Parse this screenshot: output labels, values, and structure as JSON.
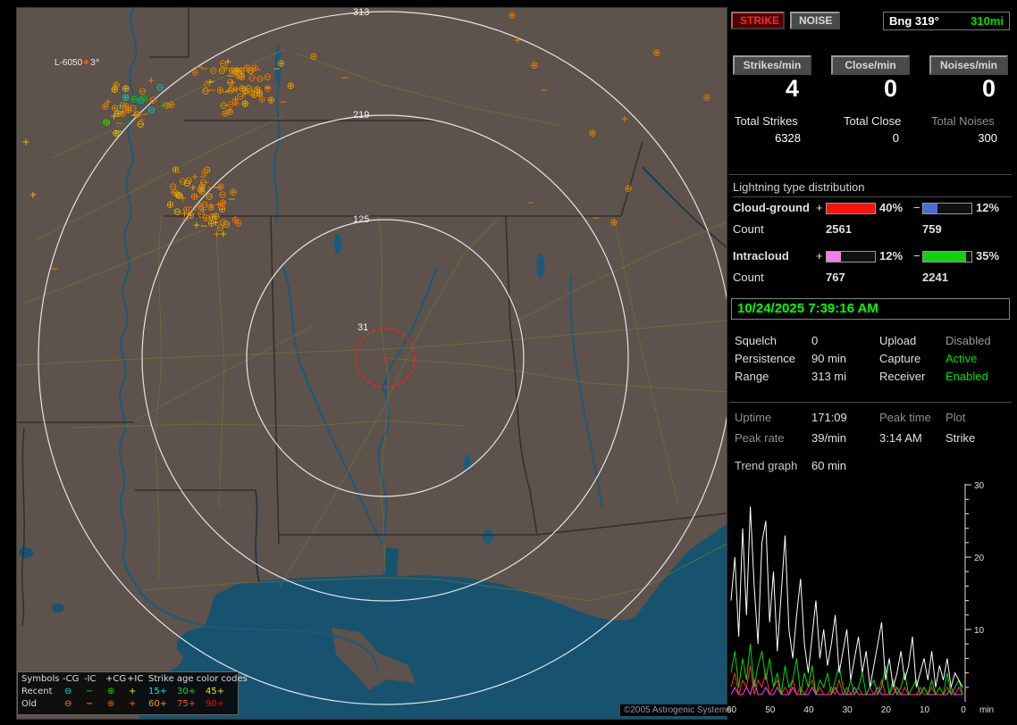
{
  "app": {
    "copyright": "©2005 Astrogenic Systems"
  },
  "map": {
    "station_label": "L-6050",
    "station_extra": "3^",
    "ring_labels": [
      "313",
      "219",
      "125",
      "31"
    ],
    "legend": {
      "header_symbols": "Symbols",
      "columns": [
        "-CG",
        "-IC",
        "+CG",
        "+IC"
      ],
      "header_ages": "Strike age color codes",
      "rows": [
        {
          "label": "Recent",
          "symbols": [
            {
              "g": "⊖",
              "c": "#00e8e8"
            },
            {
              "g": "−",
              "c": "#00e800"
            },
            {
              "g": "⊕",
              "c": "#00e800"
            },
            {
              "g": "+",
              "c": "#e8e800"
            }
          ],
          "ages": [
            {
              "t": "15+",
              "c": "#00e8e8"
            },
            {
              "t": "30+",
              "c": "#00e800"
            },
            {
              "t": "45+",
              "c": "#e8e800"
            }
          ]
        },
        {
          "label": "Old",
          "symbols": [
            {
              "g": "⊖",
              "c": "#ff9400"
            },
            {
              "g": "−",
              "c": "#ff9400"
            },
            {
              "g": "⊕",
              "c": "#ff6000"
            },
            {
              "g": "+",
              "c": "#ff6000"
            }
          ],
          "ages": [
            {
              "t": "60+",
              "c": "#ff9400"
            },
            {
              "t": "75+",
              "c": "#ff5000"
            },
            {
              "t": "90+",
              "c": "#ff0000"
            }
          ]
        }
      ]
    },
    "strike_clusters": [
      {
        "cx": 247,
        "cy": 88,
        "rx": 62,
        "ry": 34,
        "count": 72,
        "palette": [
          "#ff9400",
          "#ffb000",
          "#ff8000",
          "#ffcf00"
        ],
        "weights": [
          0.45,
          0.3,
          0.15,
          0.1
        ]
      },
      {
        "cx": 132,
        "cy": 118,
        "rx": 46,
        "ry": 38,
        "count": 40,
        "palette": [
          "#ff9400",
          "#ffcf00",
          "#00e000",
          "#00e0e0",
          "#ff6000"
        ],
        "weights": [
          0.45,
          0.2,
          0.15,
          0.12,
          0.08
        ]
      },
      {
        "cx": 210,
        "cy": 218,
        "rx": 44,
        "ry": 42,
        "count": 62,
        "palette": [
          "#ff9400",
          "#ff8000",
          "#ffb000",
          "#ffcf00"
        ],
        "weights": [
          0.45,
          0.25,
          0.2,
          0.1
        ]
      }
    ],
    "scatter_strikes": [
      {
        "x": 554,
        "y": 8,
        "s": "⊕",
        "c": "#ff9400"
      },
      {
        "x": 560,
        "y": 36,
        "s": "+",
        "c": "#ff9400"
      },
      {
        "x": 579,
        "y": 64,
        "s": "⊕",
        "c": "#ff9400"
      },
      {
        "x": 590,
        "y": 92,
        "s": "−",
        "c": "#ff9400"
      },
      {
        "x": 644,
        "y": 140,
        "s": "⊕",
        "c": "#ff9400"
      },
      {
        "x": 680,
        "y": 124,
        "s": "+",
        "c": "#ff9400"
      },
      {
        "x": 684,
        "y": 202,
        "s": "⊕",
        "c": "#ff9400"
      },
      {
        "x": 668,
        "y": 240,
        "s": "⊕",
        "c": "#ff9400"
      },
      {
        "x": 648,
        "y": 235,
        "s": "−",
        "c": "#ff9400"
      },
      {
        "x": 575,
        "y": 218,
        "s": "−",
        "c": "#ff8000"
      },
      {
        "x": 332,
        "y": 54,
        "s": "⊕",
        "c": "#ff9400"
      },
      {
        "x": 367,
        "y": 78,
        "s": "−",
        "c": "#ff9400"
      },
      {
        "x": 18,
        "y": 209,
        "s": "+",
        "c": "#ffcf00"
      },
      {
        "x": 42,
        "y": 292,
        "s": "−",
        "c": "#ff9400"
      },
      {
        "x": 10,
        "y": 150,
        "s": "+",
        "c": "#ffcf00"
      },
      {
        "x": 716,
        "y": 50,
        "s": "⊕",
        "c": "#ff9400"
      },
      {
        "x": 772,
        "y": 100,
        "s": "⊕",
        "c": "#ff8000"
      }
    ]
  },
  "panel": {
    "strike_btn": "STRIKE",
    "noise_btn": "NOISE",
    "bearing_label": "Bng 319°",
    "bearing_range": "310mi",
    "rate_buttons": [
      "Strikes/min",
      "Close/min",
      "Noises/min"
    ],
    "rates": [
      "4",
      "0",
      "0"
    ],
    "totals": [
      {
        "label": "Total Strikes",
        "value": "6328"
      },
      {
        "label": "Total Close",
        "value": "0"
      },
      {
        "label": "Total Noises",
        "value": "300"
      }
    ],
    "distribution": {
      "title": "Lightning type distribution",
      "plus_sign": "+",
      "minus_sign": "−",
      "count_label": "Count",
      "rows": [
        {
          "name": "Cloud-ground",
          "plus_pct": "40%",
          "bar_plus_fill": 100,
          "plus_color": "#ff1010",
          "minus_pct": "12%",
          "bar_minus_fill": 30,
          "minus_color": "#4a6cd4",
          "count_plus": "2561",
          "count_minus": "759"
        },
        {
          "name": "Intracloud",
          "plus_pct": "12%",
          "bar_plus_fill": 30,
          "plus_color": "#f080e8",
          "minus_pct": "35%",
          "bar_minus_fill": 88,
          "minus_color": "#10d010",
          "count_plus": "767",
          "count_minus": "2241"
        }
      ]
    },
    "datetime": "10/24/2025 7:39:16 AM",
    "settings": [
      {
        "label": "Squelch",
        "value": "0",
        "label2": "Upload",
        "value2": "Disabled",
        "value2_color": "#9a9a9a"
      },
      {
        "label": "Persistence",
        "value": "90 min",
        "label2": "Capture",
        "value2": "Active",
        "value2_color": "#00e000"
      },
      {
        "label": "Range",
        "value": "313 mi",
        "label2": "Receiver",
        "value2": "Enabled",
        "value2_color": "#00e000"
      }
    ],
    "status": {
      "uptime_label": "Uptime",
      "uptime": "171:09",
      "peaktime_label": "Peak time",
      "peaktime": "3:14 AM",
      "plot_label": "Plot",
      "plot": "Strike",
      "peakrate_label": "Peak rate",
      "peakrate": "39/min"
    },
    "trend_label": "Trend graph",
    "trend_window": "60 min"
  },
  "chart_data": {
    "type": "line",
    "title": "Trend graph",
    "window_label": "60 min",
    "x_unit": "min",
    "x_range": [
      60,
      0
    ],
    "ylim": [
      0,
      30
    ],
    "x_ticks": [
      60,
      50,
      40,
      30,
      20,
      10,
      0
    ],
    "y_ticks": [
      10,
      20,
      30
    ],
    "legend_position": "none",
    "series": [
      {
        "name": "strike-rate",
        "color": "#ffffff",
        "values": [
          14,
          20,
          9,
          24,
          12,
          27,
          16,
          8,
          22,
          25,
          11,
          18,
          7,
          15,
          23,
          10,
          6,
          12,
          17,
          8,
          4,
          9,
          14,
          6,
          10,
          5,
          8,
          12,
          4,
          7,
          10,
          3,
          6,
          9,
          4,
          7,
          2,
          5,
          8,
          11,
          3,
          6,
          2,
          4,
          7,
          3,
          5,
          9,
          2,
          4,
          6,
          3,
          7,
          2,
          5,
          3,
          6,
          2,
          4,
          3,
          2
        ]
      },
      {
        "name": "cg-rate",
        "color": "#00dd00",
        "values": [
          4,
          7,
          2,
          6,
          3,
          8,
          2,
          5,
          7,
          3,
          6,
          2,
          4,
          1,
          5,
          2,
          3,
          6,
          1,
          4,
          2,
          5,
          1,
          3,
          2,
          4,
          1,
          3,
          5,
          2,
          1,
          3,
          1,
          2,
          4,
          1,
          2,
          3,
          1,
          2,
          5,
          1,
          3,
          1,
          2,
          4,
          1,
          2,
          3,
          1,
          2,
          1,
          3,
          1,
          2,
          1,
          4,
          1,
          2,
          3,
          1
        ]
      },
      {
        "name": "close-rate",
        "color": "#ff3030",
        "values": [
          2,
          4,
          1,
          3,
          2,
          5,
          1,
          3,
          2,
          4,
          1,
          2,
          3,
          1,
          2,
          1,
          3,
          1,
          2,
          1,
          2,
          3,
          1,
          2,
          1,
          1,
          2,
          1,
          3,
          1,
          2,
          1,
          1,
          2,
          1,
          1,
          2,
          1,
          1,
          3,
          1,
          1,
          2,
          1,
          1,
          2,
          1,
          1,
          1,
          2,
          1,
          1,
          2,
          1,
          1,
          1,
          2,
          1,
          1,
          2,
          1
        ]
      },
      {
        "name": "noise-rate",
        "color": "#ff40ff",
        "values": [
          1,
          2,
          1,
          1,
          2,
          1,
          3,
          1,
          1,
          2,
          1,
          1,
          2,
          1,
          1,
          1,
          2,
          1,
          1,
          1,
          1,
          2,
          1,
          1,
          1,
          1,
          1,
          2,
          1,
          1,
          1,
          1,
          2,
          1,
          1,
          1,
          1,
          1,
          2,
          1,
          1,
          1,
          1,
          2,
          1,
          1,
          1,
          1,
          1,
          1,
          2,
          1,
          1,
          1,
          1,
          1,
          1,
          2,
          1,
          1,
          1
        ]
      }
    ]
  }
}
